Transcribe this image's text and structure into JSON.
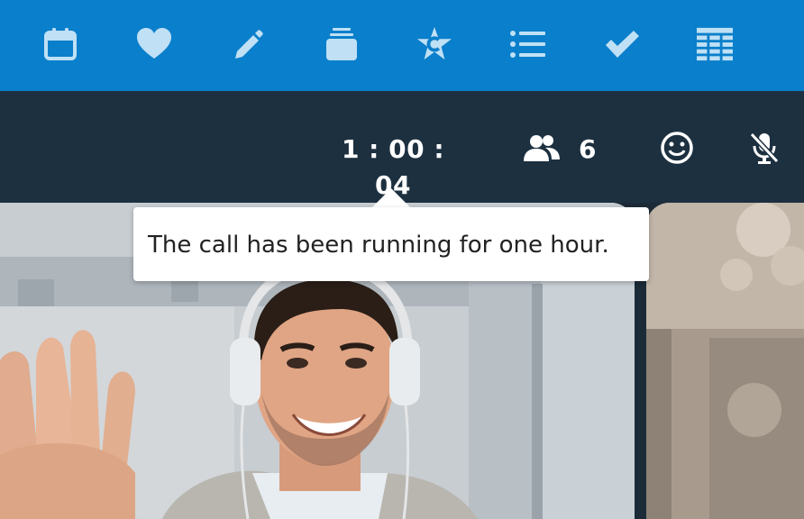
{
  "toolbar": {
    "background": "#0a7fcb",
    "icons": [
      "calendar-icon",
      "heart-icon",
      "pencil-icon",
      "stack-icon",
      "star-c-icon",
      "list-icon",
      "check-icon",
      "table-icon"
    ]
  },
  "call": {
    "duration": "1 : 00 : 04",
    "participants_count": "6",
    "bar_background": "#1d3040"
  },
  "tooltip": {
    "text": "The call has been running for one hour."
  }
}
